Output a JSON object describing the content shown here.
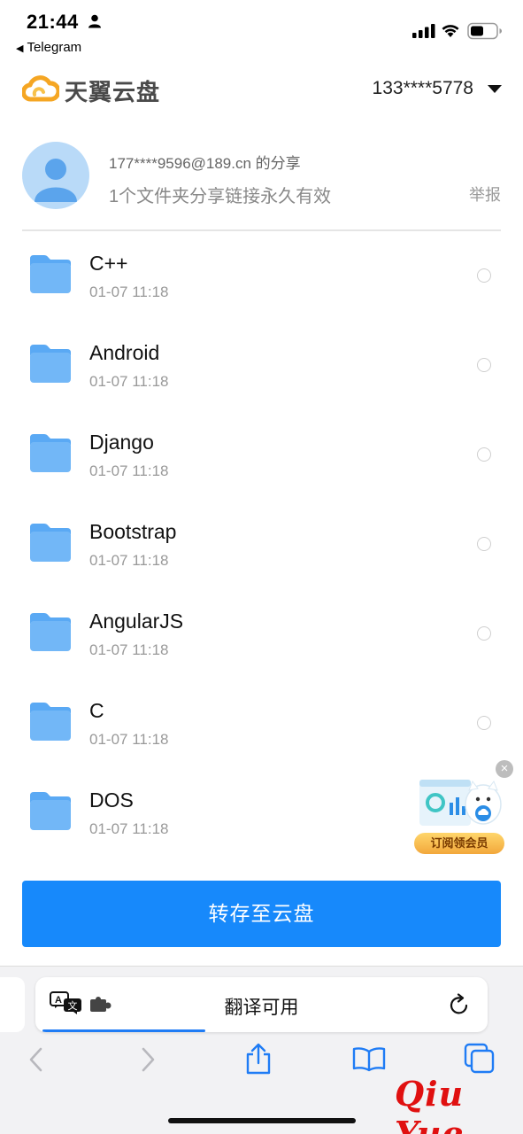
{
  "status_bar": {
    "time": "21:44",
    "back_label": "Telegram",
    "icons": [
      "person-icon",
      "cellular-signal-icon",
      "wifi-icon",
      "battery-icon"
    ]
  },
  "header": {
    "brand_name": "天翼云盘",
    "account": "133****5778"
  },
  "share": {
    "sharer": "177****9596@189.cn 的分享",
    "description": "1个文件夹分享链接永久有效",
    "report_label": "举报"
  },
  "files": [
    {
      "name": "C++",
      "date": "01-07 11:18"
    },
    {
      "name": "Android",
      "date": "01-07 11:18"
    },
    {
      "name": "Django",
      "date": "01-07 11:18"
    },
    {
      "name": "Bootstrap",
      "date": "01-07 11:18"
    },
    {
      "name": "AngularJS",
      "date": "01-07 11:18"
    },
    {
      "name": "C",
      "date": "01-07 11:18"
    },
    {
      "name": "DOS",
      "date": "01-07 11:18"
    }
  ],
  "promo": {
    "badge_label": "订阅领会员",
    "close_symbol": "×"
  },
  "save_button": {
    "label": "转存至云盘"
  },
  "browser": {
    "address_text": "翻译可用",
    "load_progress": 0.36,
    "toolbar_icons": [
      "back-icon",
      "forward-icon",
      "share-icon",
      "bookmarks-icon",
      "tabs-icon"
    ]
  },
  "watermark": "Qiu  Yue",
  "colors": {
    "accent": "#1789fb",
    "folder": "#5aa9f4",
    "logo_orange": "#f5a623",
    "watermark": "#e01010"
  }
}
